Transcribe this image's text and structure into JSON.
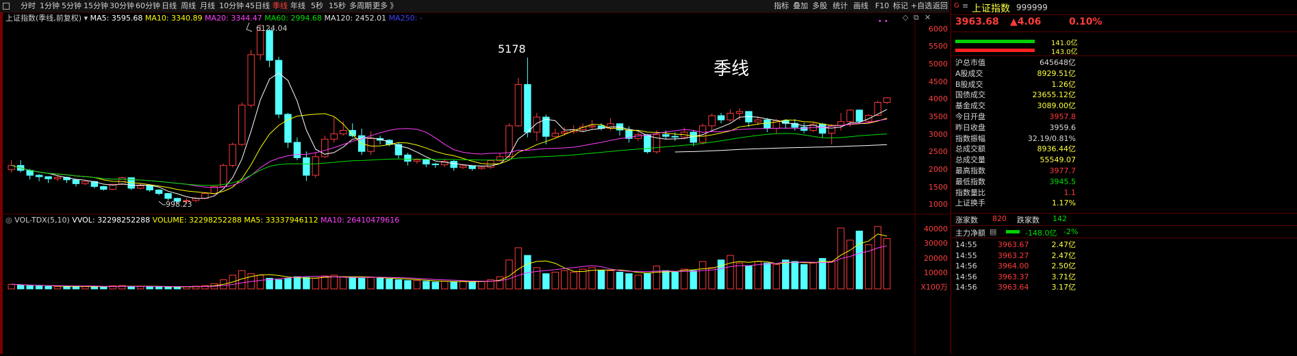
{
  "toolbar": {
    "periods": [
      "分时",
      "1分钟",
      "5分钟",
      "15分钟",
      "30分钟",
      "60分钟",
      "日线",
      "周线",
      "月线",
      "10分钟",
      "45日线",
      "季线",
      "年线",
      "5秒",
      "15秒",
      "多周期",
      "更多 》"
    ],
    "active": "季线",
    "right_items": [
      "指标",
      "叠加",
      "多股",
      "统计",
      "画线",
      "F10",
      "标记",
      "+自选",
      "返回"
    ]
  },
  "main_legend": {
    "title": "上证指数(季线,前复权)",
    "ma5": "MA5: 3595.68",
    "ma10": "MA10: 3340.89",
    "ma20": "MA20: 3344.47",
    "ma60": "MA60: 2994.68",
    "ma120": "MA120: 2452.01",
    "ma250": "MA250: -"
  },
  "annotations": {
    "high_label": "6124.04",
    "low_label": "998.23",
    "peak2": "5178",
    "period_label": "季线"
  },
  "price_axis": [
    "6000",
    "5500",
    "5000",
    "4500",
    "4000",
    "3500",
    "3000",
    "2500",
    "2000",
    "1500",
    "1000"
  ],
  "vol_legend": {
    "title": "VOL-TDX(5,10)",
    "vvol": "VVOL: 32298252288",
    "volume": "VOLUME: 32298252288",
    "ma5": "MA5: 33337946112",
    "ma10": "MA10: 26410479616"
  },
  "vol_axis": [
    "40000",
    "30000",
    "20000",
    "10000"
  ],
  "vol_unit": "X100万",
  "colors": {
    "up": "#ff3b3b",
    "down": "#54ffff",
    "ma5": "#ffffff",
    "ma10": "#ffff00",
    "ma20": "#ff40ff",
    "ma60": "#00e000",
    "ma120": "#ffffff"
  },
  "panel": {
    "title": "上证指数",
    "code": "999999",
    "price": "3963.68",
    "change": "▲4.06",
    "pct": "0.10%",
    "bar1": "141.0亿",
    "bar2": "143.0亿",
    "stats": [
      {
        "k": "沪总市值",
        "v": "645648亿",
        "c": "#d8d8d8"
      },
      {
        "k": "A股成交",
        "v": "8929.51亿",
        "c": "#ffff40"
      },
      {
        "k": "B股成交",
        "v": "1.26亿",
        "c": "#ffff40"
      },
      {
        "k": "国债成交",
        "v": "23655.12亿",
        "c": "#ffff40"
      },
      {
        "k": "基金成交",
        "v": "3089.00亿",
        "c": "#ffff40"
      },
      {
        "k": "今日开盘",
        "v": "3957.8",
        "c": "#ff3b3b"
      },
      {
        "k": "昨日收盘",
        "v": "3959.6",
        "c": "#d8d8d8"
      },
      {
        "k": "指数振幅",
        "v": "32.19/0.81%",
        "c": "#d8d8d8"
      },
      {
        "k": "总成交额",
        "v": "8936.44亿",
        "c": "#ffff40"
      },
      {
        "k": "总成交量",
        "v": "55549.07",
        "c": "#ffff40"
      },
      {
        "k": "最高指数",
        "v": "3977.7",
        "c": "#ff3b3b"
      },
      {
        "k": "最低指数",
        "v": "3945.5",
        "c": "#00e000"
      },
      {
        "k": "指数量比",
        "v": "1.1",
        "c": "#ff3b3b"
      },
      {
        "k": "上证换手",
        "v": "1.17%",
        "c": "#ffff40"
      }
    ],
    "up_label": "涨家数",
    "up_count": "820",
    "down_label": "跌家数",
    "down_count": "142",
    "flow_label": "主力净额",
    "flow_value": "-148.0亿",
    "flow_pct": "-2%",
    "ticks": [
      {
        "t": "14:55",
        "p": "3963.67",
        "v": "2.47亿"
      },
      {
        "t": "14:55",
        "p": "3963.27",
        "v": "2.47亿"
      },
      {
        "t": "14:56",
        "p": "3964.00",
        "v": "2.50亿"
      },
      {
        "t": "14:56",
        "p": "3963.37",
        "v": "3.71亿"
      },
      {
        "t": "14:56",
        "p": "3963.64",
        "v": "3.17亿"
      }
    ]
  },
  "chart_data": {
    "type": "candlestick",
    "title": "上证指数(季线,前复权)",
    "ylim": [
      900,
      6300
    ],
    "candles": [
      [
        1980,
        2100,
        2250,
        1900
      ],
      [
        2100,
        1960,
        2250,
        1900
      ],
      [
        1960,
        1820,
        2000,
        1700
      ],
      [
        1820,
        1780,
        1850,
        1650
      ],
      [
        1780,
        1720,
        1790,
        1600
      ],
      [
        1720,
        1760,
        1820,
        1650
      ],
      [
        1760,
        1690,
        1780,
        1600
      ],
      [
        1690,
        1580,
        1700,
        1500
      ],
      [
        1580,
        1640,
        1660,
        1540
      ],
      [
        1640,
        1500,
        1660,
        1450
      ],
      [
        1500,
        1420,
        1520,
        1380
      ],
      [
        1420,
        1560,
        1580,
        1400
      ],
      [
        1560,
        1750,
        1780,
        1540
      ],
      [
        1750,
        1450,
        1760,
        1400
      ],
      [
        1450,
        1520,
        1580,
        1420
      ],
      [
        1520,
        1400,
        1540,
        1350
      ],
      [
        1400,
        1300,
        1420,
        1250
      ],
      [
        1300,
        1160,
        1320,
        1100
      ],
      [
        1160,
        1080,
        1180,
        1000
      ],
      [
        1080,
        1100,
        1160,
        998
      ],
      [
        1100,
        1160,
        1200,
        1050
      ],
      [
        1160,
        1300,
        1320,
        1150
      ],
      [
        1300,
        1500,
        1520,
        1260
      ],
      [
        1500,
        2100,
        2150,
        1480
      ],
      [
        2100,
        2700,
        2750,
        2050
      ],
      [
        2700,
        3820,
        3900,
        2650
      ],
      [
        3820,
        5260,
        5400,
        3750
      ],
      [
        5260,
        5950,
        6124,
        5100
      ],
      [
        5950,
        5100,
        6000,
        4900
      ],
      [
        5100,
        3560,
        5200,
        3450
      ],
      [
        3560,
        2760,
        3600,
        2600
      ],
      [
        2760,
        2320,
        2900,
        2250
      ],
      [
        2320,
        1820,
        2500,
        1660
      ],
      [
        1820,
        2350,
        2480,
        1750
      ],
      [
        2350,
        2850,
        2950,
        2320
      ],
      [
        2850,
        3000,
        3480,
        2750
      ],
      [
        3000,
        3100,
        3360,
        2950
      ],
      [
        3100,
        2950,
        3300,
        2900
      ],
      [
        2950,
        2500,
        3150,
        2400
      ],
      [
        2500,
        2870,
        3080,
        2400
      ],
      [
        2870,
        2820,
        2950,
        2700
      ],
      [
        2820,
        2700,
        2850,
        2650
      ],
      [
        2700,
        2400,
        2750,
        2300
      ],
      [
        2400,
        2220,
        2460,
        2100
      ],
      [
        2220,
        2260,
        2300,
        2150
      ],
      [
        2260,
        2140,
        2300,
        2050
      ],
      [
        2140,
        2120,
        2180,
        2030
      ],
      [
        2120,
        2220,
        2280,
        2060
      ],
      [
        2220,
        2040,
        2250,
        1950
      ],
      [
        2040,
        2090,
        2130,
        2000
      ],
      [
        2090,
        2010,
        2100,
        1950
      ],
      [
        2010,
        2050,
        2080,
        1980
      ],
      [
        2050,
        2240,
        2260,
        2000
      ],
      [
        2240,
        2350,
        2450,
        2200
      ],
      [
        2350,
        3230,
        3300,
        2300
      ],
      [
        3230,
        4410,
        4600,
        3200
      ],
      [
        4410,
        3050,
        5178,
        2900
      ],
      [
        3050,
        3480,
        3600,
        2800
      ],
      [
        3480,
        2930,
        3550,
        2700
      ],
      [
        2930,
        3020,
        3150,
        2900
      ],
      [
        3020,
        3060,
        3200,
        2950
      ],
      [
        3060,
        3120,
        3250,
        3000
      ],
      [
        3120,
        3200,
        3300,
        3050
      ],
      [
        3200,
        3230,
        3400,
        3150
      ],
      [
        3230,
        3160,
        3300,
        3100
      ],
      [
        3160,
        3290,
        3450,
        3100
      ],
      [
        3290,
        3110,
        3300,
        2950
      ],
      [
        3110,
        2870,
        3220,
        2750
      ],
      [
        2870,
        2980,
        3050,
        2800
      ],
      [
        2980,
        2490,
        3000,
        2440
      ],
      [
        2490,
        2980,
        3100,
        2440
      ],
      [
        2980,
        2930,
        3100,
        2850
      ],
      [
        2930,
        2910,
        3050,
        2800
      ],
      [
        2910,
        3050,
        3180,
        2850
      ],
      [
        3050,
        2760,
        3100,
        2650
      ],
      [
        2760,
        3230,
        3290,
        2700
      ],
      [
        3230,
        3520,
        3580,
        3100
      ],
      [
        3520,
        3400,
        3600,
        3300
      ],
      [
        3400,
        3590,
        3700,
        3350
      ],
      [
        3590,
        3640,
        3730,
        3400
      ],
      [
        3640,
        3340,
        3650,
        3200
      ],
      [
        3340,
        3400,
        3500,
        3250
      ],
      [
        3400,
        3160,
        3450,
        3050
      ],
      [
        3160,
        3380,
        3420,
        3000
      ],
      [
        3380,
        3300,
        3420,
        3150
      ],
      [
        3300,
        3190,
        3420,
        3100
      ],
      [
        3190,
        3100,
        3320,
        3020
      ],
      [
        3100,
        3280,
        3320,
        3050
      ],
      [
        3280,
        3020,
        3320,
        2900
      ],
      [
        3020,
        3240,
        3280,
        2700
      ],
      [
        3240,
        3350,
        3600,
        3100
      ],
      [
        3350,
        3680,
        3700,
        3200
      ],
      [
        3680,
        3360,
        3700,
        3290
      ],
      [
        3360,
        3530,
        3560,
        3300
      ],
      [
        3530,
        3900,
        3950,
        3500
      ],
      [
        3900,
        4030,
        4050,
        3850
      ]
    ],
    "volumes": [
      3000,
      2500,
      2000,
      1800,
      1700,
      1600,
      1500,
      1700,
      1500,
      1600,
      1400,
      2000,
      2200,
      1700,
      1600,
      1500,
      1400,
      1200,
      1300,
      1500,
      1800,
      2200,
      3500,
      6000,
      9000,
      12000,
      10000,
      9000,
      7000,
      6000,
      7000,
      8000,
      7500,
      7000,
      8500,
      9000,
      8000,
      7500,
      7000,
      7500,
      7000,
      6500,
      6000,
      5500,
      5500,
      5000,
      4500,
      5000,
      4500,
      5000,
      4500,
      5000,
      6000,
      8000,
      19000,
      27000,
      22000,
      14000,
      10000,
      11000,
      12000,
      11000,
      13000,
      14000,
      12000,
      12000,
      11000,
      10000,
      9000,
      10000,
      15000,
      12000,
      11000,
      13000,
      12000,
      18000,
      14000,
      19000,
      22000,
      17000,
      15000,
      18000,
      17000,
      16000,
      19000,
      18000,
      16000,
      17000,
      20000,
      18000,
      40000,
      32000,
      38000,
      29000,
      41000,
      33000
    ]
  }
}
